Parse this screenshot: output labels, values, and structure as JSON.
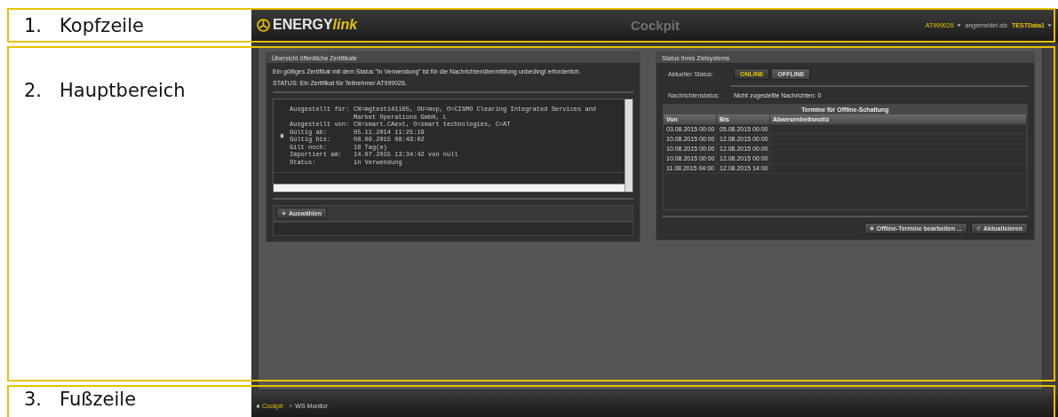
{
  "annotations": [
    {
      "number": "1.",
      "label": "Kopfzeile"
    },
    {
      "number": "2.",
      "label": "Hauptbereich"
    },
    {
      "number": "3.",
      "label": "Fußzeile"
    }
  ],
  "header": {
    "logo_main": "ENERGY",
    "logo_accent": "link",
    "title": "Cockpit",
    "participant": "AT999026",
    "signed_in_label": "angemeldet als",
    "user": "TESTData1"
  },
  "certificates": {
    "title": "Übersicht öffentliche Zertifikate",
    "info": "Ein gültiges Zertifikat mit dem Status \"in Verwendung\" ist für die Nachrichtenübermittlung unbedingt erforderlich.",
    "status": "STATUS: Ein Zertifikat für Teilnehmer AT999026.",
    "fields": [
      {
        "label": "Ausgestellt für:",
        "value": "CN=mgtest141105, OU=mvp, O=CISMO Clearing Integrated Services and Market Operations GmbH, L"
      },
      {
        "label": "Ausgestellt von:",
        "value": "CN=smart.CAext, O=smart technologies, C=AT"
      },
      {
        "label": "Gültig ab:",
        "value": "05.11.2014 11:25:19"
      },
      {
        "label": "Gültig bis:",
        "value": "08.09.2015 08:48:02"
      },
      {
        "label": "Gilt noch:",
        "value": "18 Tag(e)"
      },
      {
        "label": "Importiert am:",
        "value": "14.07.2015 13:34:42 von null"
      },
      {
        "label": "Status:",
        "value": "in Verwendung"
      }
    ],
    "select_button": "Auswählen"
  },
  "target_status": {
    "title": "Status Ihres Zielsystems",
    "current_label": "Aktueller Status:",
    "options": [
      {
        "label": "ONLINE",
        "selected": true
      },
      {
        "label": "OFFLINE",
        "selected": false
      }
    ],
    "message_label": "Nachrichtenstatus:",
    "message_value": "Nicht zugestellte Nachrichten: 0",
    "table": {
      "title": "Termine für Offline-Schaltung",
      "columns": [
        "Von",
        "Bis",
        "Abwesenheitsnotiz"
      ],
      "rows": [
        [
          "03.08.2015 00:00",
          "05.08.2015 00:00",
          ""
        ],
        [
          "10.08.2015 00:00",
          "12.08.2015 00:00",
          ""
        ],
        [
          "10.08.2015 00:00",
          "12.08.2015 00:00",
          ""
        ],
        [
          "10.08.2015 00:00",
          "12.08.2015 00:00",
          ""
        ],
        [
          "11.08.2015 04:00",
          "12.08.2015 14:00",
          ""
        ]
      ]
    },
    "buttons": [
      {
        "kind": "edit",
        "label": "Offline-Termine bearbeiten ..."
      },
      {
        "kind": "refresh",
        "label": "Aktualisieren"
      }
    ]
  },
  "footer": {
    "nav": [
      {
        "kind": "home",
        "label": "Cockpit",
        "selected": true
      },
      {
        "kind": "monitor",
        "label": "WS Monitor",
        "selected": false
      }
    ]
  }
}
